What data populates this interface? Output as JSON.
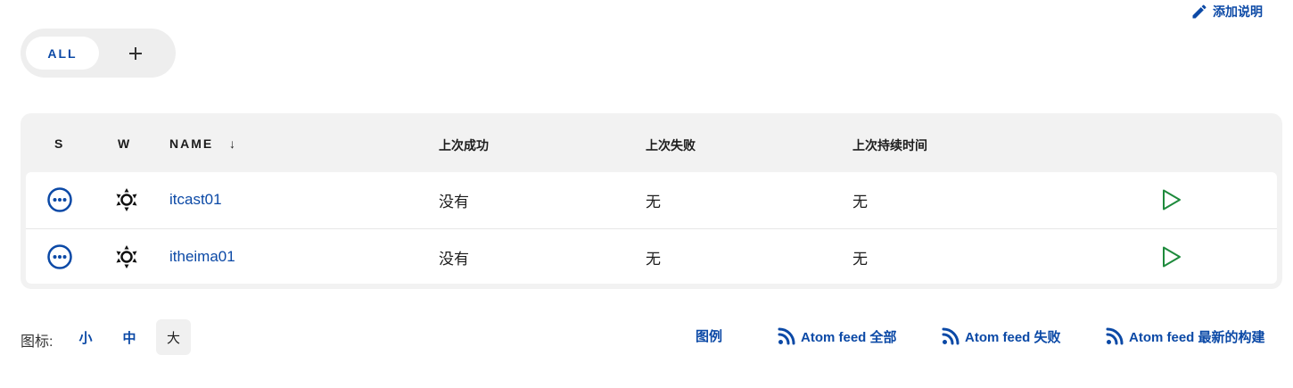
{
  "header": {
    "add_description": "添加说明"
  },
  "tabs": {
    "all": "ALL"
  },
  "table": {
    "columns": {
      "s": "S",
      "w": "W",
      "name": "NAME",
      "sort_arrow": "↓",
      "last_success": "上次成功",
      "last_failure": "上次失败",
      "last_duration": "上次持续时间"
    },
    "rows": [
      {
        "name": "itcast01",
        "last_success": "没有",
        "last_failure": "无",
        "last_duration": "无"
      },
      {
        "name": "itheima01",
        "last_success": "没有",
        "last_failure": "无",
        "last_duration": "无"
      }
    ]
  },
  "footer": {
    "icon_label": "图标:",
    "sizes": {
      "small": "小",
      "medium": "中",
      "large": "大"
    },
    "legend": "图例",
    "feed_all": "Atom feed 全部",
    "feed_failed": "Atom feed 失败",
    "feed_latest": "Atom feed 最新的构建"
  },
  "colors": {
    "link": "#0b49a6",
    "run": "#1e8a3c",
    "header_bg": "#f2f2f2"
  }
}
